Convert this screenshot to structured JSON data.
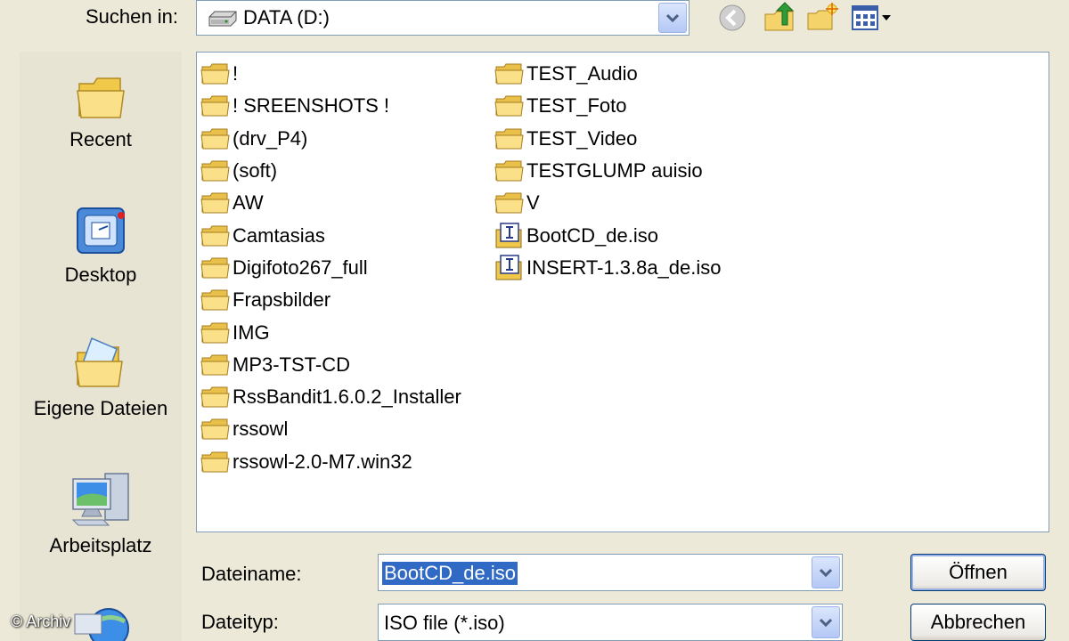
{
  "toolbar": {
    "look_in_label": "Suchen in:",
    "look_in_value": "DATA (D:)",
    "drive_icon": "drive-icon",
    "back_icon": "back-icon",
    "up_icon": "up-folder-icon",
    "new_folder_icon": "new-folder-icon",
    "views_icon": "views-menu-icon"
  },
  "places": [
    {
      "label": "Recent",
      "icon": "recent-folder-icon"
    },
    {
      "label": "Desktop",
      "icon": "desktop-icon"
    },
    {
      "label": "Eigene Dateien",
      "icon": "my-documents-icon"
    },
    {
      "label": "Arbeitsplatz",
      "icon": "my-computer-icon"
    },
    {
      "label": "",
      "icon": "network-icon"
    }
  ],
  "files": {
    "column1": [
      {
        "name": "!",
        "type": "folder"
      },
      {
        "name": "! SREENSHOTS !",
        "type": "folder"
      },
      {
        "name": "(drv_P4)",
        "type": "folder"
      },
      {
        "name": "(soft)",
        "type": "folder"
      },
      {
        "name": "AW",
        "type": "folder"
      },
      {
        "name": "Camtasias",
        "type": "folder"
      },
      {
        "name": "Digifoto267_full",
        "type": "folder"
      },
      {
        "name": "Frapsbilder",
        "type": "folder"
      },
      {
        "name": "IMG",
        "type": "folder"
      },
      {
        "name": "MP3-TST-CD",
        "type": "folder"
      },
      {
        "name": "RssBandit1.6.0.2_Installer",
        "type": "folder"
      },
      {
        "name": "rssowl",
        "type": "folder"
      },
      {
        "name": "rssowl-2.0-M7.win32",
        "type": "folder"
      }
    ],
    "column2": [
      {
        "name": "TEST_Audio",
        "type": "folder"
      },
      {
        "name": "TEST_Foto",
        "type": "folder"
      },
      {
        "name": "TEST_Video",
        "type": "folder"
      },
      {
        "name": "TESTGLUMP auisio",
        "type": "folder"
      },
      {
        "name": "V",
        "type": "folder"
      },
      {
        "name": "BootCD_de.iso",
        "type": "iso"
      },
      {
        "name": "INSERT-1.3.8a_de.iso",
        "type": "iso"
      }
    ]
  },
  "filename": {
    "label": "Dateiname:",
    "value": "BootCD_de.iso"
  },
  "filetype": {
    "label": "Dateityp:",
    "value": "ISO file (*.iso)"
  },
  "buttons": {
    "open": "Öffnen",
    "cancel": "Abbrechen"
  },
  "watermark": "© Archiv",
  "colors": {
    "dialog_bg": "#ece9d8",
    "selection": "#316ac5",
    "border": "#7f9db9"
  }
}
